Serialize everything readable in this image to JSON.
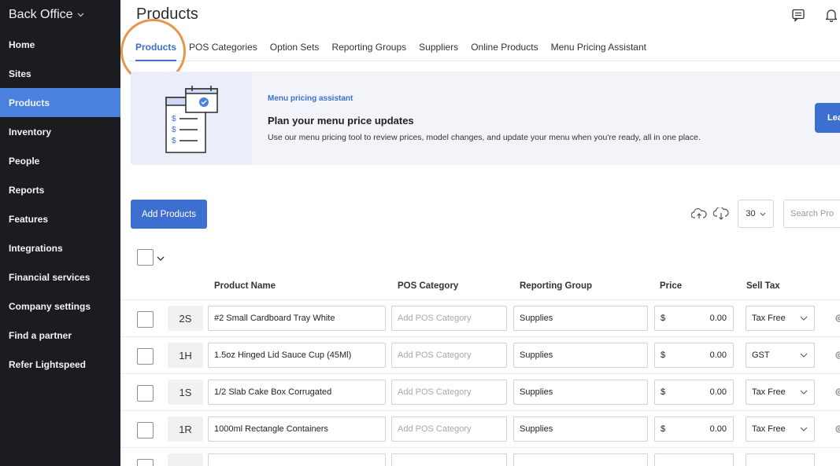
{
  "sidebar": {
    "brand": "Back Office",
    "items": [
      {
        "label": "Home"
      },
      {
        "label": "Sites"
      },
      {
        "label": "Products"
      },
      {
        "label": "Inventory"
      },
      {
        "label": "People"
      },
      {
        "label": "Reports"
      },
      {
        "label": "Features"
      },
      {
        "label": "Integrations"
      },
      {
        "label": "Financial services"
      },
      {
        "label": "Company settings"
      },
      {
        "label": "Find a partner"
      },
      {
        "label": "Refer Lightspeed"
      }
    ],
    "active": "Products"
  },
  "header": {
    "title": "Products",
    "icons": [
      "chat-icon",
      "bell-icon"
    ]
  },
  "tabs": [
    {
      "label": "Products"
    },
    {
      "label": "POS Categories"
    },
    {
      "label": "Option Sets"
    },
    {
      "label": "Reporting Groups"
    },
    {
      "label": "Suppliers"
    },
    {
      "label": "Online Products"
    },
    {
      "label": "Menu Pricing Assistant"
    }
  ],
  "banner": {
    "kicker": "Menu pricing assistant",
    "title": "Plan your menu price updates",
    "description": "Use our menu pricing tool to review prices, model changes, and update your menu when you're ready, all in one place.",
    "button_label": "Lea"
  },
  "toolbar": {
    "add_label": "Add Products",
    "per_page": "30",
    "search_placeholder": "Search Pro"
  },
  "table": {
    "columns": [
      "Product Name",
      "POS Category",
      "Reporting Group",
      "Price",
      "Sell Tax"
    ],
    "rows": [
      {
        "code": "2S",
        "name": "#2 Small Cardboard Tray White",
        "pos_category": "Add POS Category",
        "reporting_group": "Supplies",
        "currency": "$",
        "price": "0.00",
        "tax": "Tax Free"
      },
      {
        "code": "1H",
        "name": "1.5oz Hinged Lid Sauce Cup (45Ml)",
        "pos_category": "Add POS Category",
        "reporting_group": "Supplies",
        "currency": "$",
        "price": "0.00",
        "tax": "GST"
      },
      {
        "code": "1S",
        "name": "1/2 Slab Cake Box Corrugated",
        "pos_category": "Add POS Category",
        "reporting_group": "Supplies",
        "currency": "$",
        "price": "0.00",
        "tax": "Tax Free"
      },
      {
        "code": "1R",
        "name": "1000ml Rectangle Containers",
        "pos_category": "Add POS Category",
        "reporting_group": "Supplies",
        "currency": "$",
        "price": "0.00",
        "tax": "Tax Free"
      }
    ]
  },
  "colors": {
    "sidebar_bg": "#1b1c1f",
    "accent": "#3d6fd1",
    "highlight_ring": "#e7964d"
  }
}
